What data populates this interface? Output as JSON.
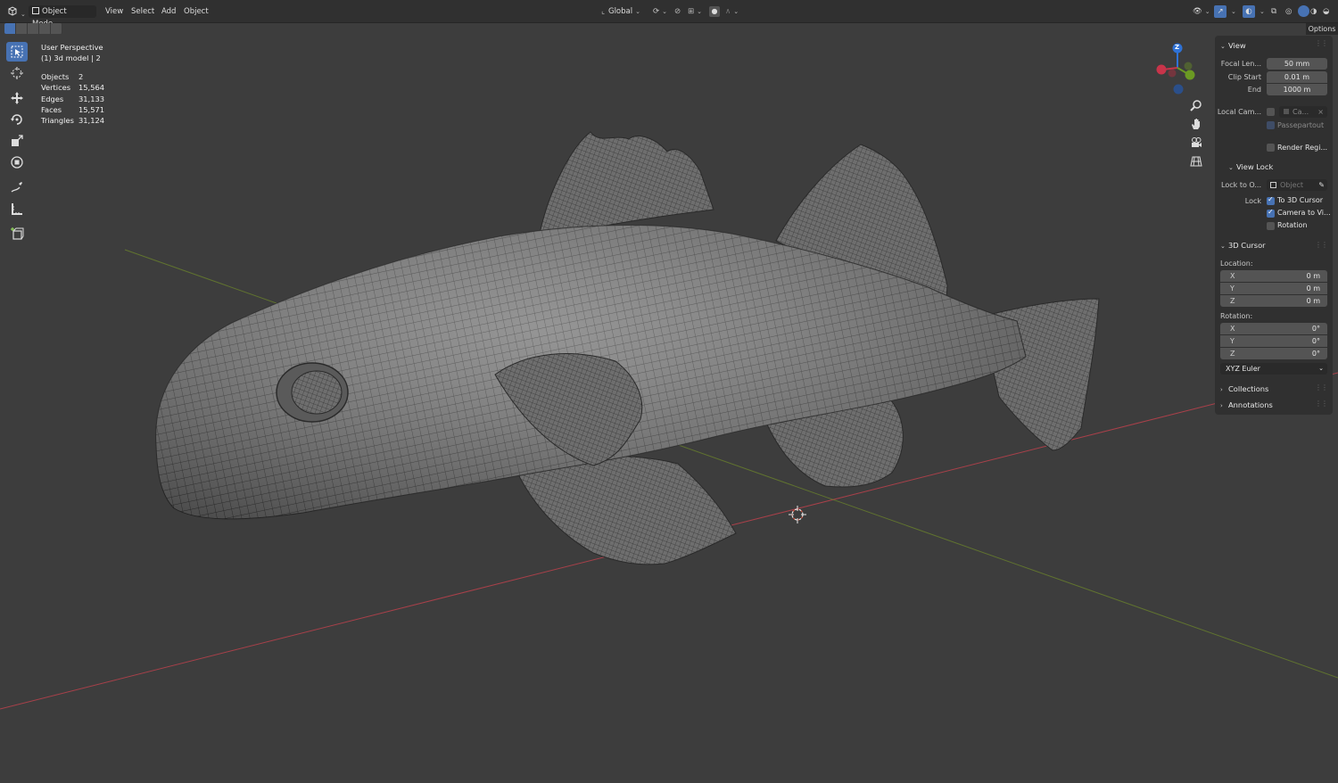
{
  "header": {
    "editor_type": "3D Viewport",
    "mode": "Object Mode",
    "menus": [
      "View",
      "Select",
      "Add",
      "Object"
    ],
    "transform_orientation": "Global",
    "options_label": "Options"
  },
  "overlay_info": {
    "view_name": "User Perspective",
    "collection": "(1) 3d model | 2",
    "stats": [
      {
        "label": "Objects",
        "value": "2"
      },
      {
        "label": "Vertices",
        "value": "15,564"
      },
      {
        "label": "Edges",
        "value": "31,133"
      },
      {
        "label": "Faces",
        "value": "15,571"
      },
      {
        "label": "Triangles",
        "value": "31,124"
      }
    ]
  },
  "gizmo": {
    "z_label": "Z"
  },
  "npanel": {
    "view": {
      "title": "View",
      "focal_length_label": "Focal Len...",
      "focal_length": "50 mm",
      "clip_start_label": "Clip Start",
      "clip_start": "0.01 m",
      "end_label": "End",
      "end": "1000 m",
      "local_camera_label": "Local Cam...",
      "local_camera_value": "Ca...",
      "passepartout_label": "Passepartout",
      "render_region_label": "Render Regi..."
    },
    "view_lock": {
      "title": "View Lock",
      "lock_to_object_label": "Lock to O...",
      "lock_to_object_placeholder": "Object",
      "lock_label": "Lock",
      "to_3d_cursor": "To 3D Cursor",
      "camera_to_view": "Camera to Vi...",
      "rotation": "Rotation"
    },
    "cursor": {
      "title": "3D Cursor",
      "location_label": "Location:",
      "location": [
        {
          "axis": "X",
          "value": "0 m"
        },
        {
          "axis": "Y",
          "value": "0 m"
        },
        {
          "axis": "Z",
          "value": "0 m"
        }
      ],
      "rotation_label": "Rotation:",
      "rotation": [
        {
          "axis": "X",
          "value": "0°"
        },
        {
          "axis": "Y",
          "value": "0°"
        },
        {
          "axis": "Z",
          "value": "0°"
        }
      ],
      "rotation_mode": "XYZ Euler"
    },
    "collections_title": "Collections",
    "annotations_title": "Annotations"
  },
  "colors": {
    "accent": "#4772b3",
    "viewport_bg": "#3d3d3d",
    "x_axis": "#a8404a",
    "y_axis": "#6f8a2a"
  }
}
